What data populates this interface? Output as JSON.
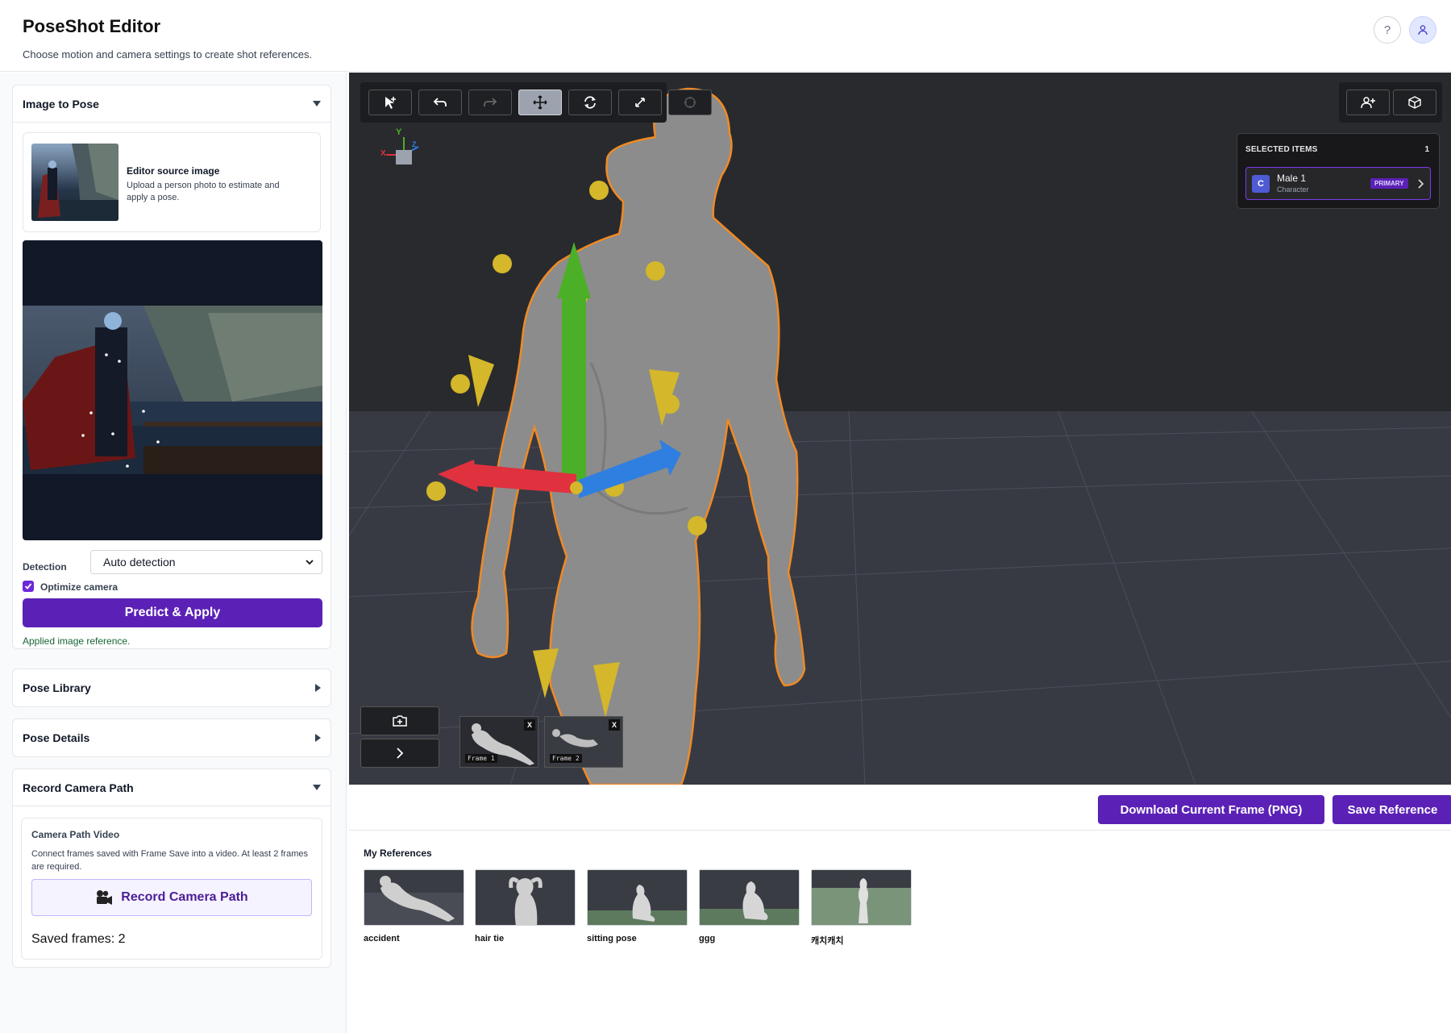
{
  "header": {
    "title": "PoseShot Editor",
    "subtitle": "Choose motion and camera settings to create shot references.",
    "help_glyph": "?"
  },
  "image_to_pose": {
    "title": "Image to Pose",
    "source_title": "Editor source image",
    "source_desc": "Upload a person photo to estimate and apply a pose.",
    "detection_label": "Detection",
    "detection_value": "Auto detection",
    "optimize_label": "Optimize camera",
    "optimize_checked": true,
    "predict_label": "Predict & Apply",
    "status": "Applied image reference."
  },
  "pose_library": {
    "title": "Pose Library"
  },
  "pose_details": {
    "title": "Pose Details"
  },
  "record_camera": {
    "title": "Record Camera Path",
    "card_title": "Camera Path Video",
    "card_desc": "Connect frames saved with Frame Save into a video. At least 2 frames are required.",
    "button_label": "Record Camera Path",
    "saved_frames": "Saved frames: 2"
  },
  "viewport": {
    "gizmo": {
      "y": "Y",
      "x": "X",
      "z": "Z"
    },
    "selected": {
      "title": "SELECTED ITEMS",
      "count": "1",
      "item_initial": "C",
      "item_name": "Male 1",
      "item_type": "Character",
      "item_badge": "PRIMARY"
    },
    "frames": [
      {
        "label": "Frame 1",
        "remove": "X"
      },
      {
        "label": "Frame 2",
        "remove": "X"
      }
    ]
  },
  "actions": {
    "download": "Download Current Frame (PNG)",
    "save": "Save Reference"
  },
  "references": {
    "title": "My References",
    "items": [
      {
        "label": "accident"
      },
      {
        "label": "hair tie"
      },
      {
        "label": "sitting pose"
      },
      {
        "label": "ggg"
      },
      {
        "label": "캐치캐치"
      }
    ]
  },
  "colors": {
    "accent": "#5b21b6",
    "gizmo_y": "#4caf28",
    "gizmo_x": "#e0313e",
    "gizmo_z": "#2f7fe0",
    "joint": "#d4b72a",
    "outline": "#f08a24"
  }
}
